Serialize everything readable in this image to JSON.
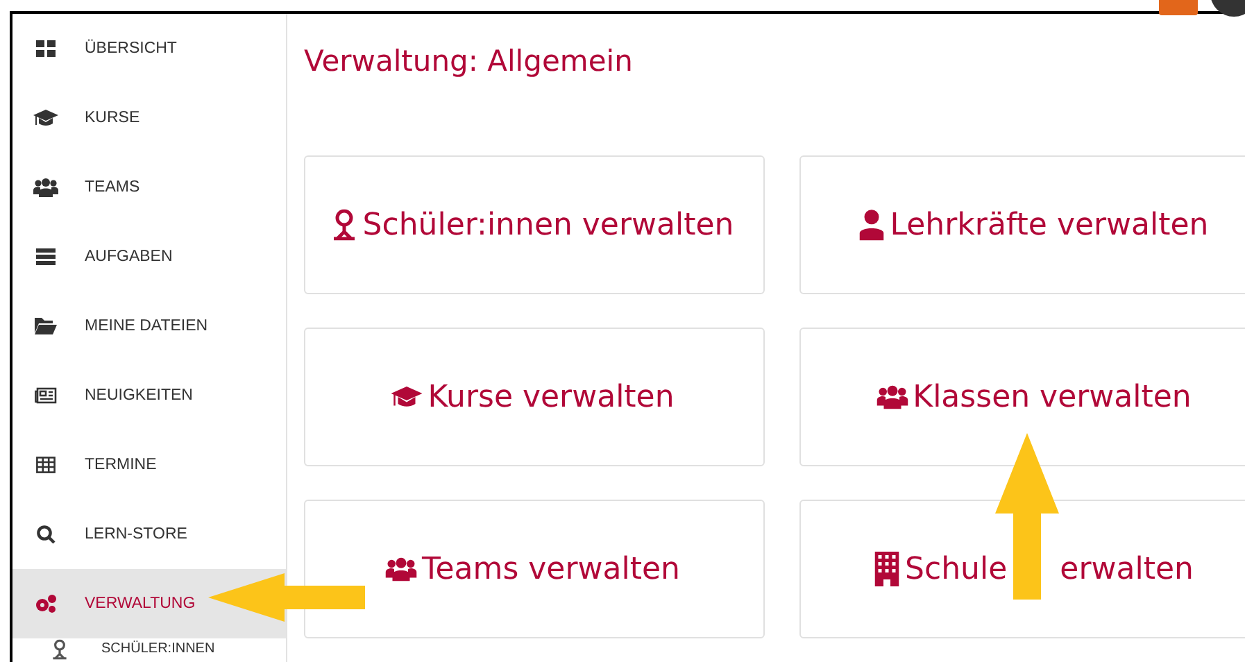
{
  "sidebar": {
    "items": [
      {
        "label": "ÜBERSICHT",
        "selected": false
      },
      {
        "label": "KURSE",
        "selected": false
      },
      {
        "label": "TEAMS",
        "selected": false
      },
      {
        "label": "AUFGABEN",
        "selected": false
      },
      {
        "label": "MEINE DATEIEN",
        "selected": false
      },
      {
        "label": "NEUIGKEITEN",
        "selected": false
      },
      {
        "label": "TERMINE",
        "selected": false
      },
      {
        "label": "LERN-STORE",
        "selected": false
      },
      {
        "label": "VERWALTUNG",
        "selected": true
      }
    ],
    "subitems": [
      {
        "label": "SCHÜLER:INNEN",
        "selected": false
      }
    ]
  },
  "page_title": "Verwaltung: Allgemein",
  "cards": [
    {
      "label": [
        "Schüler:innen verwalten"
      ]
    },
    {
      "label": [
        "Lehrkräfte verwalten"
      ]
    },
    {
      "label": [
        "Kurse verwalten"
      ]
    },
    {
      "label": [
        "Klassen verwalten"
      ]
    },
    {
      "label": [
        "Teams verwalten"
      ]
    },
    {
      "label": [
        "Schule",
        "erwalten"
      ]
    }
  ]
}
